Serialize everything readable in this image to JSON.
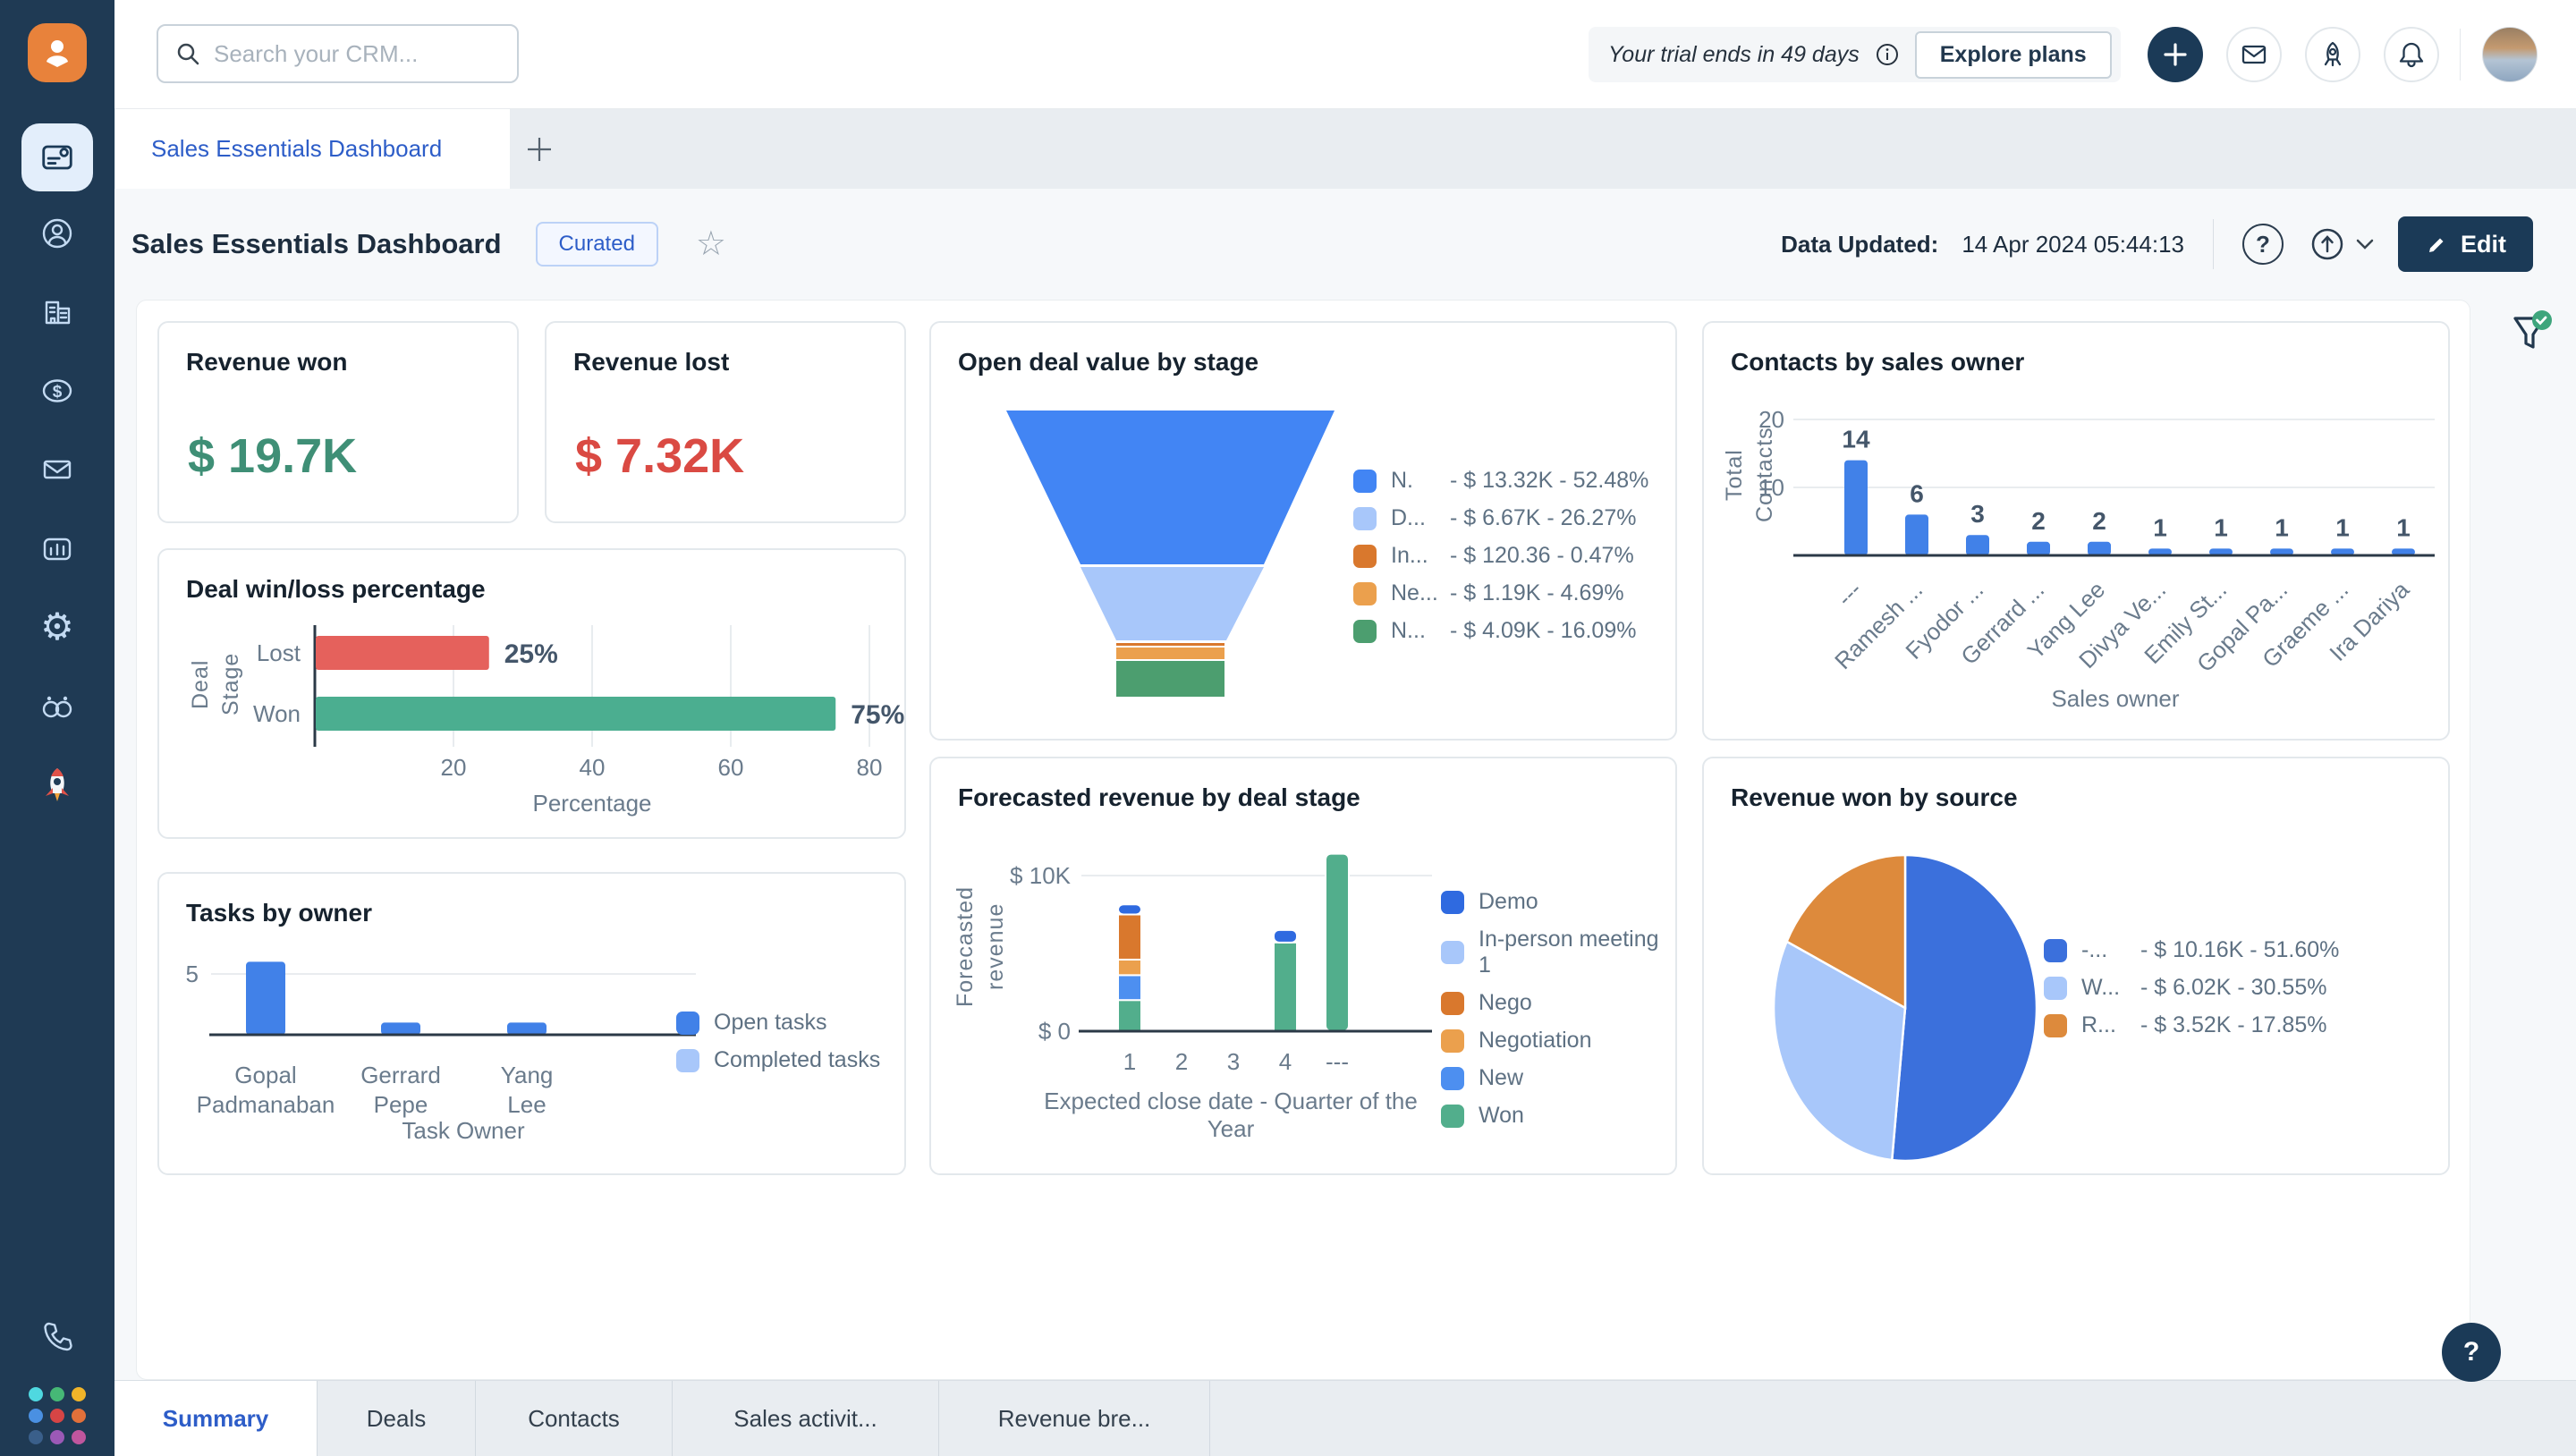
{
  "topbar": {
    "search_placeholder": "Search your CRM...",
    "trial_text": "Your trial ends in 49 days",
    "explore_plans_label": "Explore plans"
  },
  "tab_strip": {
    "active_tab": "Sales Essentials Dashboard"
  },
  "page_header": {
    "title": "Sales Essentials Dashboard",
    "badge": "Curated",
    "updated_label": "Data Updated:",
    "updated_value": "14 Apr 2024 05:44:13",
    "edit_label": "Edit"
  },
  "kpis": {
    "revenue_won": {
      "title": "Revenue won",
      "value": "$ 19.7K",
      "color": "#3f8f76"
    },
    "revenue_lost": {
      "title": "Revenue lost",
      "value": "$ 7.32K",
      "color": "#da4a43"
    }
  },
  "bottom_tabs": {
    "items": [
      "Summary",
      "Deals",
      "Contacts",
      "Sales activit...",
      "Revenue bre..."
    ],
    "active_index": 0
  },
  "help_fab_label": "?",
  "sidebar_icons": [
    "freshworks-logo",
    "dashboard",
    "contacts",
    "accounts",
    "deals",
    "email",
    "analytics",
    "settings",
    "freddy-ai",
    "rocket",
    "phone",
    "apps-grid"
  ],
  "topbar_icons": [
    "search",
    "info",
    "plus",
    "mail",
    "rocket",
    "bell",
    "avatar"
  ],
  "chart_data": [
    {
      "id": "deal_winloss",
      "type": "bar",
      "orientation": "horizontal",
      "title": "Deal win/loss percentage",
      "ylabel": "Deal Stage",
      "xlabel": "Percentage",
      "categories": [
        "Lost",
        "Won"
      ],
      "values": [
        25,
        75
      ],
      "value_labels": [
        "25%",
        "75%"
      ],
      "colors": [
        "#e5615c",
        "#4bae90"
      ],
      "xticks": [
        20,
        40,
        60,
        80
      ],
      "xlim": [
        0,
        85
      ],
      "grid": true
    },
    {
      "id": "tasks_by_owner",
      "type": "bar",
      "title": "Tasks by owner",
      "xlabel": "Task Owner",
      "categories": [
        "Gopal Padmanaban",
        "Gerrard Pepe",
        "Yang Lee"
      ],
      "series": [
        {
          "name": "Open tasks",
          "color": "#4181e8",
          "values": [
            6,
            1,
            1
          ]
        },
        {
          "name": "Completed tasks",
          "color": "#a8c7fa",
          "values": [
            0,
            0,
            0
          ]
        }
      ],
      "yticks": [
        5
      ],
      "ylim": [
        0,
        7
      ],
      "legend_position": "right"
    },
    {
      "id": "open_deal_value",
      "type": "funnel",
      "title": "Open deal value by stage",
      "stages": [
        {
          "label": "N.",
          "value_text": "- $ 13.32K - 52.48%",
          "pct": 52.48,
          "color": "#4285f4"
        },
        {
          "label": "D...",
          "value_text": "- $ 6.67K - 26.27%",
          "pct": 26.27,
          "color": "#a8c7fa"
        },
        {
          "label": "In...",
          "value_text": "- $ 120.36 - 0.47%",
          "pct": 0.47,
          "color": "#d9782d"
        },
        {
          "label": "Ne...",
          "value_text": "- $ 1.19K - 4.69%",
          "pct": 4.69,
          "color": "#eba04d"
        },
        {
          "label": "N...",
          "value_text": "- $ 4.09K - 16.09%",
          "pct": 16.09,
          "color": "#4c9e6f"
        }
      ]
    },
    {
      "id": "forecasted_revenue",
      "type": "stacked-bar",
      "title": "Forecasted revenue by deal stage",
      "ylabel": "Forecasted revenue",
      "xlabel": "Expected close date - Quarter of the Year",
      "yticks": [
        "$ 0",
        "$ 10K"
      ],
      "ylim_k": [
        0,
        12
      ],
      "categories": [
        "1",
        "2",
        "3",
        "4",
        "---"
      ],
      "legend": [
        {
          "name": "Demo",
          "color": "#2f6ae0"
        },
        {
          "name": "In-person meeting 1",
          "color": "#a8c7fa"
        },
        {
          "name": "Nego",
          "color": "#d9782d"
        },
        {
          "name": "Negotiation",
          "color": "#eba04d"
        },
        {
          "name": "New",
          "color": "#4d8ff0"
        },
        {
          "name": "Won",
          "color": "#52ae8c"
        }
      ],
      "bars": [
        {
          "category": "1",
          "segments": [
            {
              "name": "Won",
              "value_k": 2.0
            },
            {
              "name": "New",
              "value_k": 1.6
            },
            {
              "name": "Negotiation",
              "value_k": 1.0
            },
            {
              "name": "Nego",
              "value_k": 2.9
            },
            {
              "name": "Demo",
              "value_k": 0.65
            }
          ]
        },
        {
          "category": "4",
          "segments": [
            {
              "name": "Won",
              "value_k": 5.7
            },
            {
              "name": "Demo",
              "value_k": 0.8
            }
          ]
        },
        {
          "category": "---",
          "segments": [
            {
              "name": "Won",
              "value_k": 11.4
            }
          ]
        }
      ]
    },
    {
      "id": "contacts_by_sales_owner",
      "type": "bar",
      "title": "Contacts by sales owner",
      "ylabel": "Total Contacts",
      "xlabel": "Sales owner",
      "categories": [
        "---",
        "Ramesh ...",
        "Fyodor ...",
        "Gerrard ...",
        "Yang Lee",
        "Divya Ve...",
        "Emily St...",
        "Gopal Pa...",
        "Graeme ...",
        "Ira Dariya"
      ],
      "values": [
        14,
        6,
        3,
        2,
        2,
        1,
        1,
        1,
        1,
        1
      ],
      "color": "#4181e8",
      "yticks": [
        10,
        20
      ],
      "ylim": [
        0,
        22
      ]
    },
    {
      "id": "revenue_won_by_source",
      "type": "pie",
      "title": "Revenue won by source",
      "slices": [
        {
          "label": "-...",
          "value_text": "- $ 10.16K - 51.60%",
          "pct": 51.6,
          "color": "#3b70dc"
        },
        {
          "label": "W...",
          "value_text": "- $ 6.02K - 30.55%",
          "pct": 30.55,
          "color": "#a8c7fa"
        },
        {
          "label": "R...",
          "value_text": "- $ 3.52K - 17.85%",
          "pct": 17.85,
          "color": "#dd8a3c"
        }
      ]
    }
  ]
}
